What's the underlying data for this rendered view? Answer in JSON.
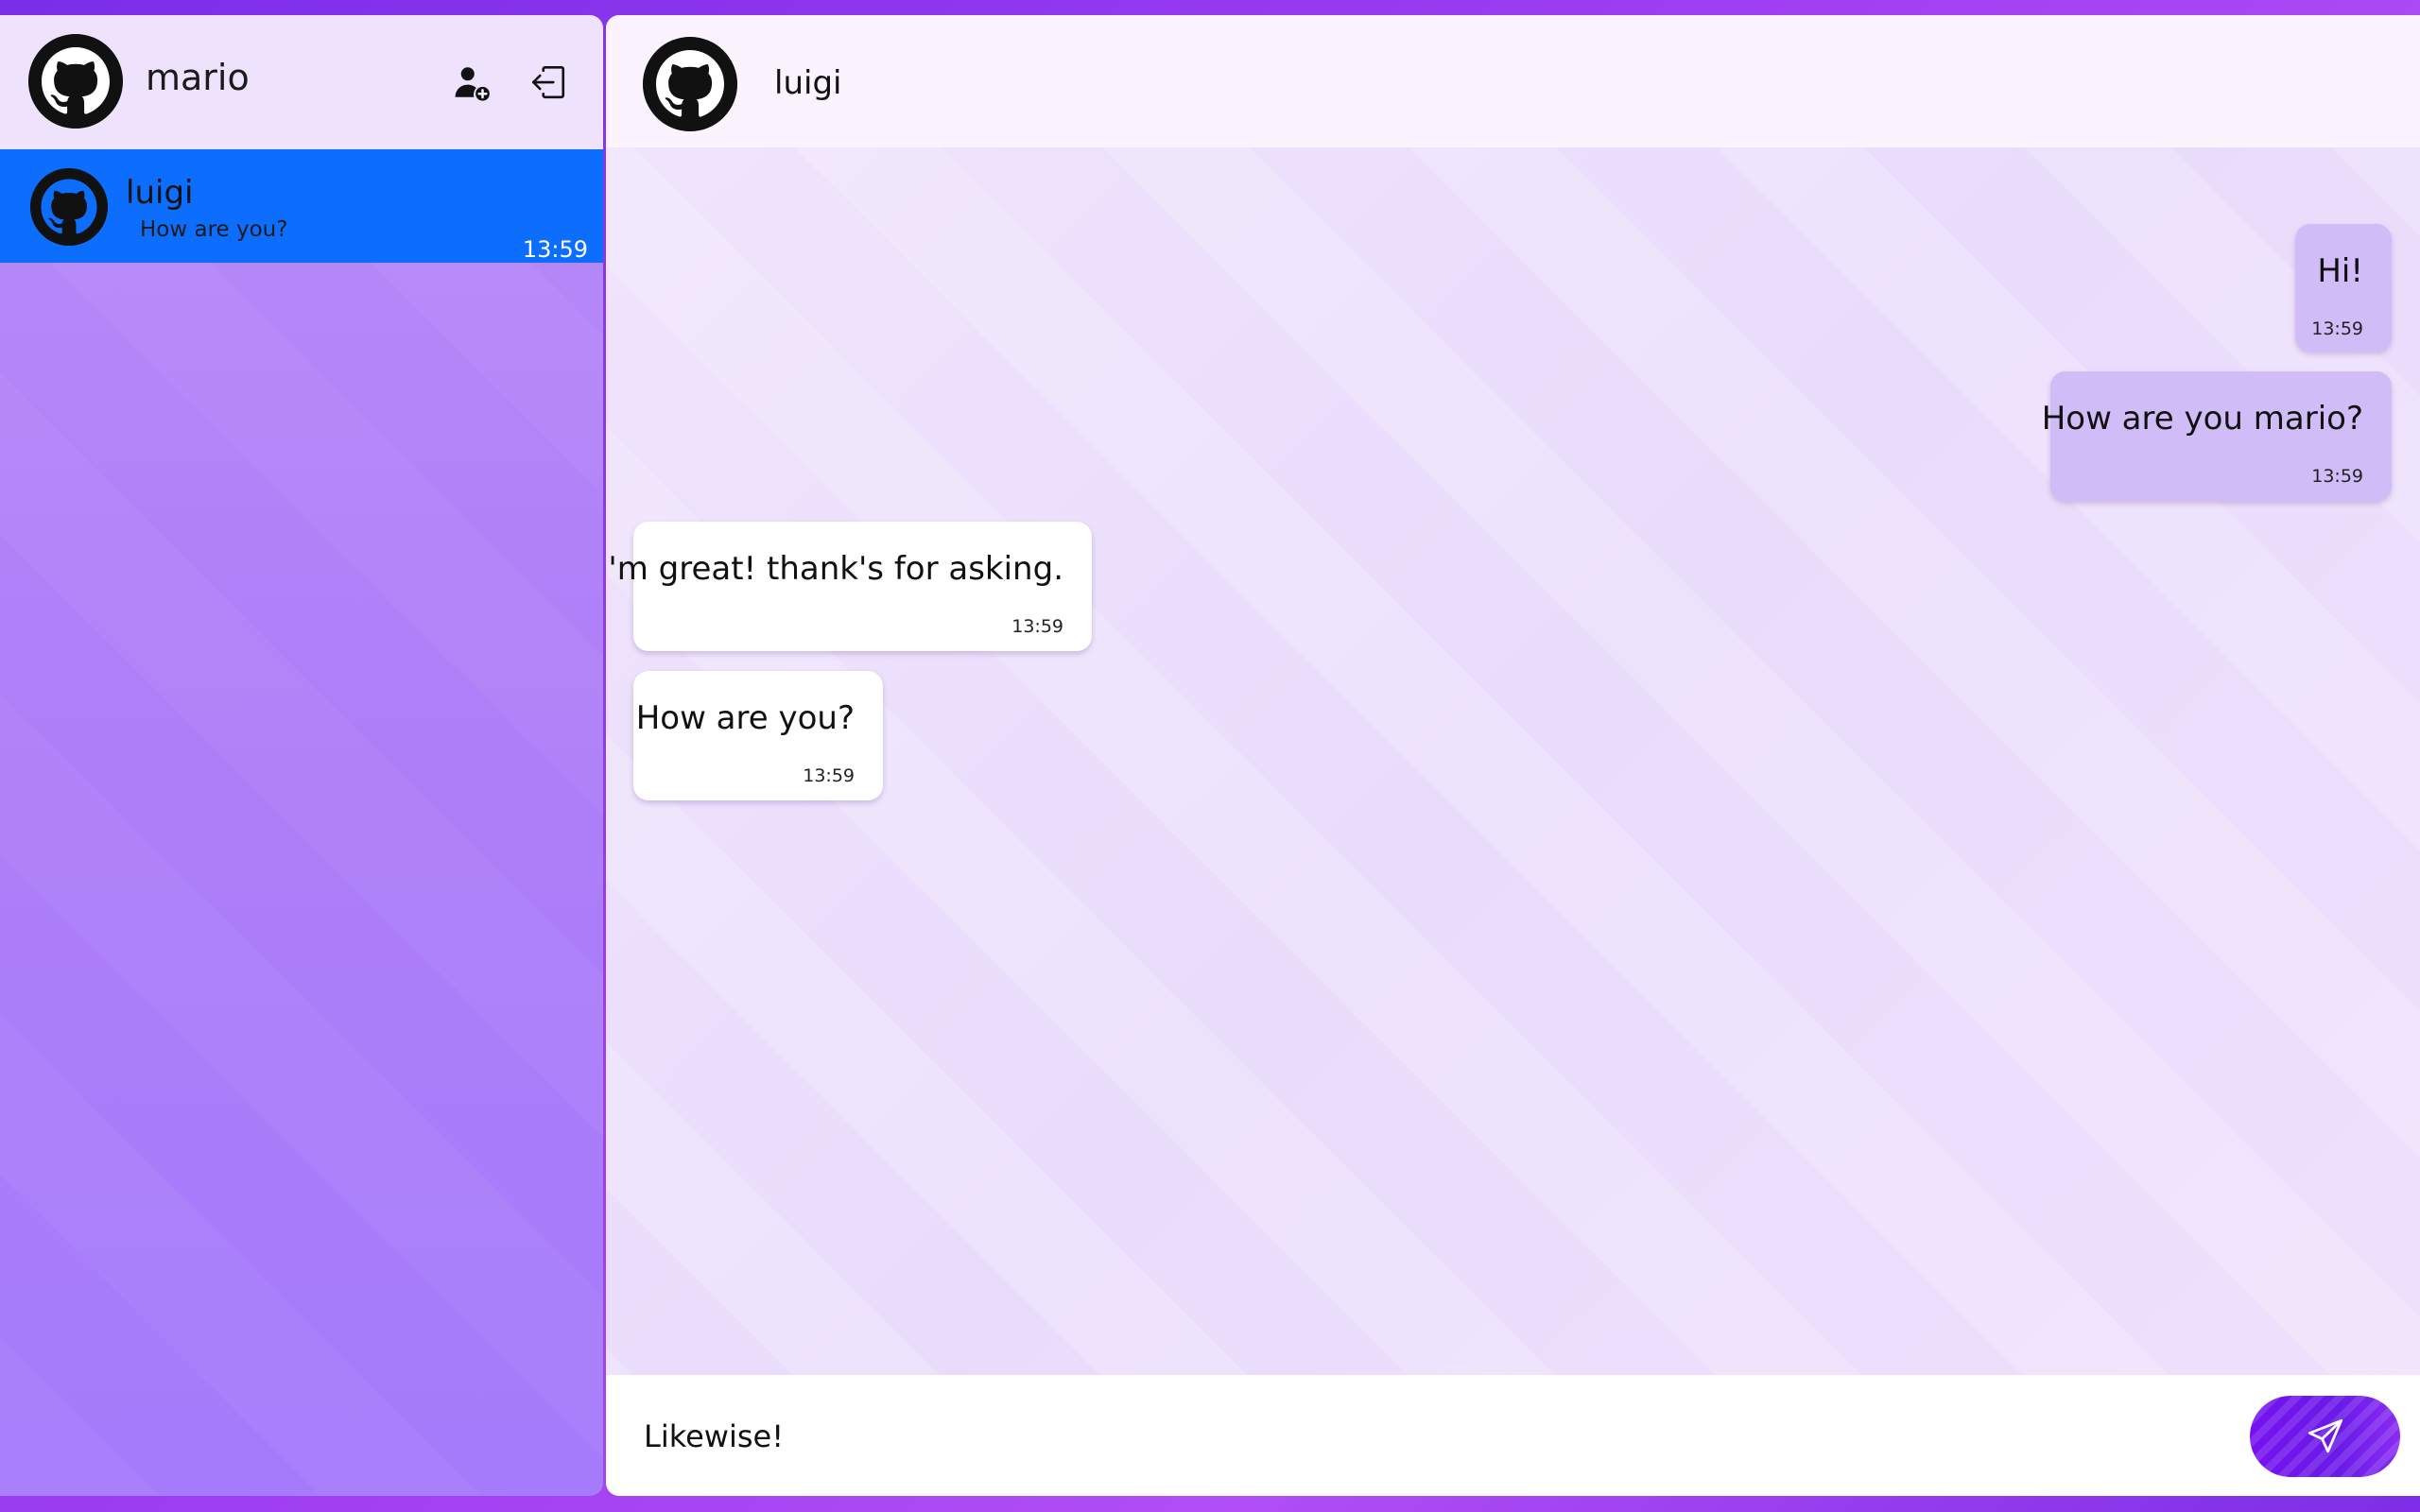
{
  "current_user": {
    "name": "mario",
    "avatar_icon": "github-octocat-icon"
  },
  "sidebar": {
    "actions": {
      "add_contact_icon": "add-user-icon",
      "logout_icon": "logout-icon"
    },
    "chats": [
      {
        "name": "luigi",
        "preview": "How are you?",
        "time": "13:59",
        "avatar_icon": "github-octocat-icon",
        "selected": true
      }
    ]
  },
  "conversation": {
    "contact_name": "luigi",
    "avatar_icon": "github-octocat-icon",
    "messages": [
      {
        "direction": "outgoing",
        "text": "Hi!",
        "time": "13:59"
      },
      {
        "direction": "outgoing",
        "text": "How are you mario?",
        "time": "13:59"
      },
      {
        "direction": "incoming",
        "text": "I'm great! thank's for asking.",
        "time": "13:59"
      },
      {
        "direction": "incoming",
        "text": "How are you?",
        "time": "13:59"
      }
    ]
  },
  "composer": {
    "value": "Likewise!",
    "send_icon": "send-icon"
  },
  "colors": {
    "selected_chat": "#0d6efd",
    "outgoing_bubble": "#d0bdf7",
    "incoming_bubble": "#ffffff",
    "send_button": "#7612f0"
  }
}
